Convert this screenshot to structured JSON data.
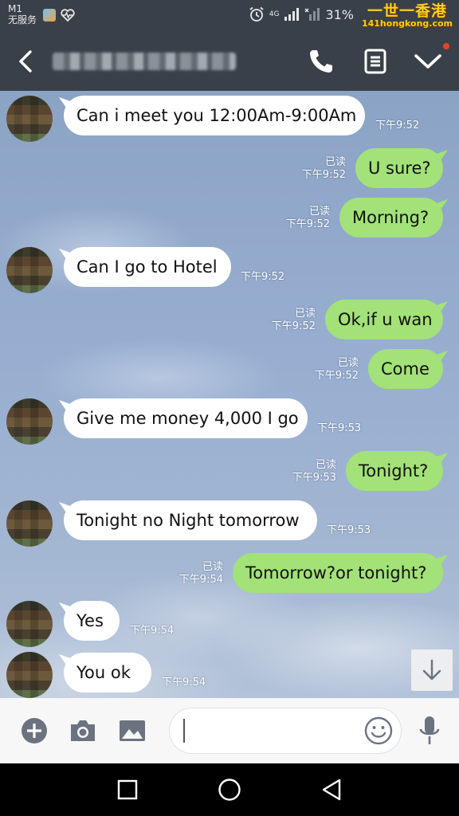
{
  "status_bar": {
    "carrier": "M1",
    "service": "无服务",
    "network": "4G",
    "battery": "31%"
  },
  "watermark": {
    "main": "一世一香港",
    "sub": "141hongkong.com"
  },
  "header": {
    "back_icon": "back-arrow-icon",
    "call_icon": "phone-icon",
    "notes_icon": "notes-icon",
    "menu_icon": "chevron-down-icon"
  },
  "messages": [
    {
      "dir": "in",
      "text": "Can i meet you 12:00Am-9:00Am",
      "time": "下午9:52"
    },
    {
      "dir": "out",
      "text": "U sure?",
      "read": "已读",
      "time": "下午9:52"
    },
    {
      "dir": "out",
      "text": "Morning?",
      "read": "已读",
      "time": "下午9:52"
    },
    {
      "dir": "in",
      "text": "Can I go to Hotel",
      "time": "下午9:52"
    },
    {
      "dir": "out",
      "text": "Ok,if u wan",
      "read": "已读",
      "time": "下午9:52"
    },
    {
      "dir": "out",
      "text": "Come",
      "read": "已读",
      "time": "下午9:52"
    },
    {
      "dir": "in",
      "text": "Give me money 4,000 I go",
      "time": "下午9:53"
    },
    {
      "dir": "out",
      "text": "Tonight?",
      "read": "已读",
      "time": "下午9:53"
    },
    {
      "dir": "in",
      "text": "Tonight no Night tomorrow",
      "time": "下午9:53"
    },
    {
      "dir": "out",
      "text": "Tomorrow?or tonight?",
      "read": "已读",
      "time": "下午9:54"
    },
    {
      "dir": "in",
      "text": "Yes",
      "time": "下午9:54"
    },
    {
      "dir": "in",
      "text": "You ok",
      "time": "下午9:54"
    }
  ],
  "input_bar": {
    "add_icon": "plus-circle-icon",
    "camera_icon": "camera-icon",
    "image_icon": "image-icon",
    "emoji_icon": "smiley-icon",
    "mic_icon": "microphone-icon",
    "message_value": ""
  },
  "nav_bar": {
    "recents_icon": "square-icon",
    "home_icon": "circle-icon",
    "back_icon": "triangle-back-icon"
  },
  "colors": {
    "header_bg": "#3a4049",
    "incoming_bubble": "#ffffff",
    "outgoing_bubble": "#a2e278"
  }
}
